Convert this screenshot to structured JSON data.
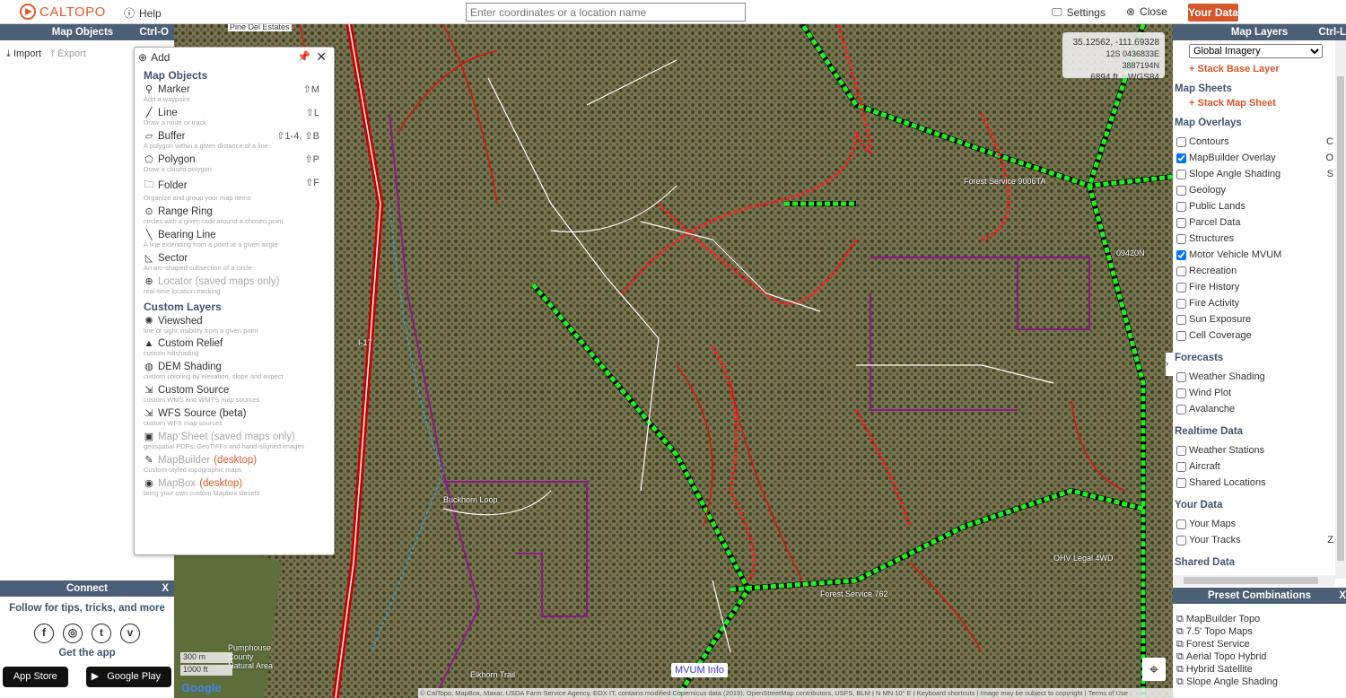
{
  "topbar": {
    "logo": "CALTOPO",
    "help": "Help",
    "search_placeholder": "Enter coordinates or a location name",
    "settings": "Settings",
    "close": "Close",
    "your_data": "Your Data"
  },
  "left": {
    "title": "Map Objects",
    "shortcut": "Ctrl-O",
    "import": "Import",
    "export": "Export"
  },
  "add_popup": {
    "title": "Add",
    "map_objects_heading": "Map Objects",
    "map_objects": [
      {
        "label": "Marker",
        "sub": "Add a waypoint",
        "key": "⇧M",
        "icon": "marker-icon",
        "glyph": "⚲"
      },
      {
        "label": "Line",
        "sub": "Draw a route or track",
        "key": "⇧L",
        "icon": "line-icon",
        "glyph": "╱"
      },
      {
        "label": "Buffer",
        "sub": "A polygon within a given distance of a line",
        "key": "⇧1-4, ⇧B",
        "icon": "buffer-icon",
        "glyph": "▱"
      },
      {
        "label": "Polygon",
        "sub": "Draw a closed polygon",
        "key": "⇧P",
        "icon": "polygon-icon",
        "glyph": "⬠"
      },
      {
        "label": "Folder",
        "sub": "Organize and group your map items",
        "key": "⇧F",
        "icon": "folder-icon",
        "glyph": "🗀"
      },
      {
        "label": "Range Ring",
        "sub": "circles with a given radii around a chosen point",
        "key": "",
        "icon": "range-ring-icon",
        "glyph": "⊙"
      },
      {
        "label": "Bearing Line",
        "sub": "A line extending from a point at a given angle",
        "key": "",
        "icon": "bearing-line-icon",
        "glyph": "╲"
      },
      {
        "label": "Sector",
        "sub": "An arc-shaped subsection of a circle",
        "key": "",
        "icon": "sector-icon",
        "glyph": "◺"
      },
      {
        "label": "Locator (saved maps only)",
        "sub": "real-time location tracking",
        "key": "",
        "icon": "locator-icon",
        "glyph": "⊕",
        "dim": true
      }
    ],
    "custom_heading": "Custom Layers",
    "custom_layers": [
      {
        "label": "Viewshed",
        "sub": "line of sight visibility from a given point",
        "icon": "viewshed-icon",
        "glyph": "✺"
      },
      {
        "label": "Custom Relief",
        "sub": "custom hillshading",
        "icon": "relief-icon",
        "glyph": "▲"
      },
      {
        "label": "DEM Shading",
        "sub": "custom coloring by elevation, slope and aspect",
        "icon": "dem-icon",
        "glyph": "◍"
      },
      {
        "label": "Custom Source",
        "sub": "custom WMS and WMTS map sources",
        "icon": "source-icon",
        "glyph": "⇲"
      },
      {
        "label": "WFS Source (beta)",
        "sub": "custom WFS map sources",
        "icon": "wfs-icon",
        "glyph": "⇲"
      },
      {
        "label": "Map Sheet (saved maps only)",
        "sub": "geospatial PDFs, GeoTIFFs and hand-aligned images",
        "icon": "map-sheet-icon",
        "glyph": "▣",
        "dim": true
      },
      {
        "label": "MapBuilder",
        "tag": "(desktop)",
        "sub": "Custom-styled topographic maps",
        "icon": "mapbuilder-icon",
        "glyph": "✎",
        "dim": true
      },
      {
        "label": "MapBox",
        "tag": "(desktop)",
        "sub": "bring your own custom Mapbox tilesets",
        "icon": "mapbox-icon",
        "glyph": "◉",
        "dim": true
      }
    ]
  },
  "connect": {
    "title": "Connect",
    "close": "X",
    "follow": "Follow for tips, tricks, and more",
    "social": [
      "f",
      "◎",
      "t",
      "v"
    ],
    "get_app": "Get the app",
    "app_store": "App Store",
    "google_play": "Google Play"
  },
  "map": {
    "coords": "35.12562, -111.69328",
    "utm": "12S 0436833E 3887194N",
    "elevation": "6894 ft",
    "datum": "WGS84",
    "scale_m": "300 m",
    "scale_ft": "1000 ft",
    "mvum_info": "MVUM Info",
    "attribution": "© CalTopo, MapBox, Maxar, USDA Farm Service Agency, EOX IT, contains modified Copernicus data (2019), OpenStreetMap contributors, USFS, BLM | N MN 10° E | Keyboard shortcuts | Image may be subject to copyright | Terms of Use",
    "labels": [
      "Pine Del Estates",
      "Forest Service 762",
      "Forest Service 9006TA",
      "OHV Legal 4WD",
      "Buckhorn Loop",
      "Elkhorn Trail",
      "Pumphouse County Natural Area",
      "I-17",
      "09420N"
    ]
  },
  "right": {
    "title": "Map Layers",
    "shortcut": "Ctrl-L",
    "base_layer": "Global Imagery",
    "stack_base": "+ Stack Base Layer",
    "sheets_heading": "Map Sheets",
    "stack_sheet": "+ Stack Map Sheet",
    "overlays_heading": "Map Overlays",
    "overlays": [
      {
        "label": "Contours",
        "checked": false,
        "key": "C"
      },
      {
        "label": "MapBuilder Overlay",
        "checked": true,
        "key": "O"
      },
      {
        "label": "Slope Angle Shading",
        "checked": false,
        "key": "S"
      },
      {
        "label": "Geology",
        "checked": false
      },
      {
        "label": "Public Lands",
        "checked": false
      },
      {
        "label": "Parcel Data",
        "checked": false
      },
      {
        "label": "Structures",
        "checked": false
      },
      {
        "label": "Motor Vehicle MVUM",
        "checked": true
      },
      {
        "label": "Recreation",
        "checked": false
      },
      {
        "label": "Fire History",
        "checked": false
      },
      {
        "label": "Fire Activity",
        "checked": false
      },
      {
        "label": "Sun Exposure",
        "checked": false
      },
      {
        "label": "Cell Coverage",
        "checked": false
      }
    ],
    "forecasts_heading": "Forecasts",
    "forecasts": [
      {
        "label": "Weather Shading"
      },
      {
        "label": "Wind Plot"
      },
      {
        "label": "Avalanche"
      }
    ],
    "realtime_heading": "Realtime Data",
    "realtime": [
      {
        "label": "Weather Stations"
      },
      {
        "label": "Aircraft"
      },
      {
        "label": "Shared Locations"
      }
    ],
    "yourdata_heading": "Your Data",
    "yourdata": [
      {
        "label": "Your Maps",
        "key": ""
      },
      {
        "label": "Your Tracks",
        "key": "Z"
      }
    ],
    "shared_heading": "Shared Data"
  },
  "presets": {
    "title": "Preset Combinations",
    "close": "X",
    "items": [
      "MapBuilder Topo",
      "7.5' Topo Maps",
      "Forest Service",
      "Aerial Topo Hybrid",
      "Hybrid Satellite",
      "Slope Angle Shading"
    ]
  },
  "colors": {
    "accent": "#d4582a",
    "header": "#4b5f77",
    "trail": "#22dd22",
    "road_red": "#dd1111",
    "boundary": "#8b1a8b"
  }
}
